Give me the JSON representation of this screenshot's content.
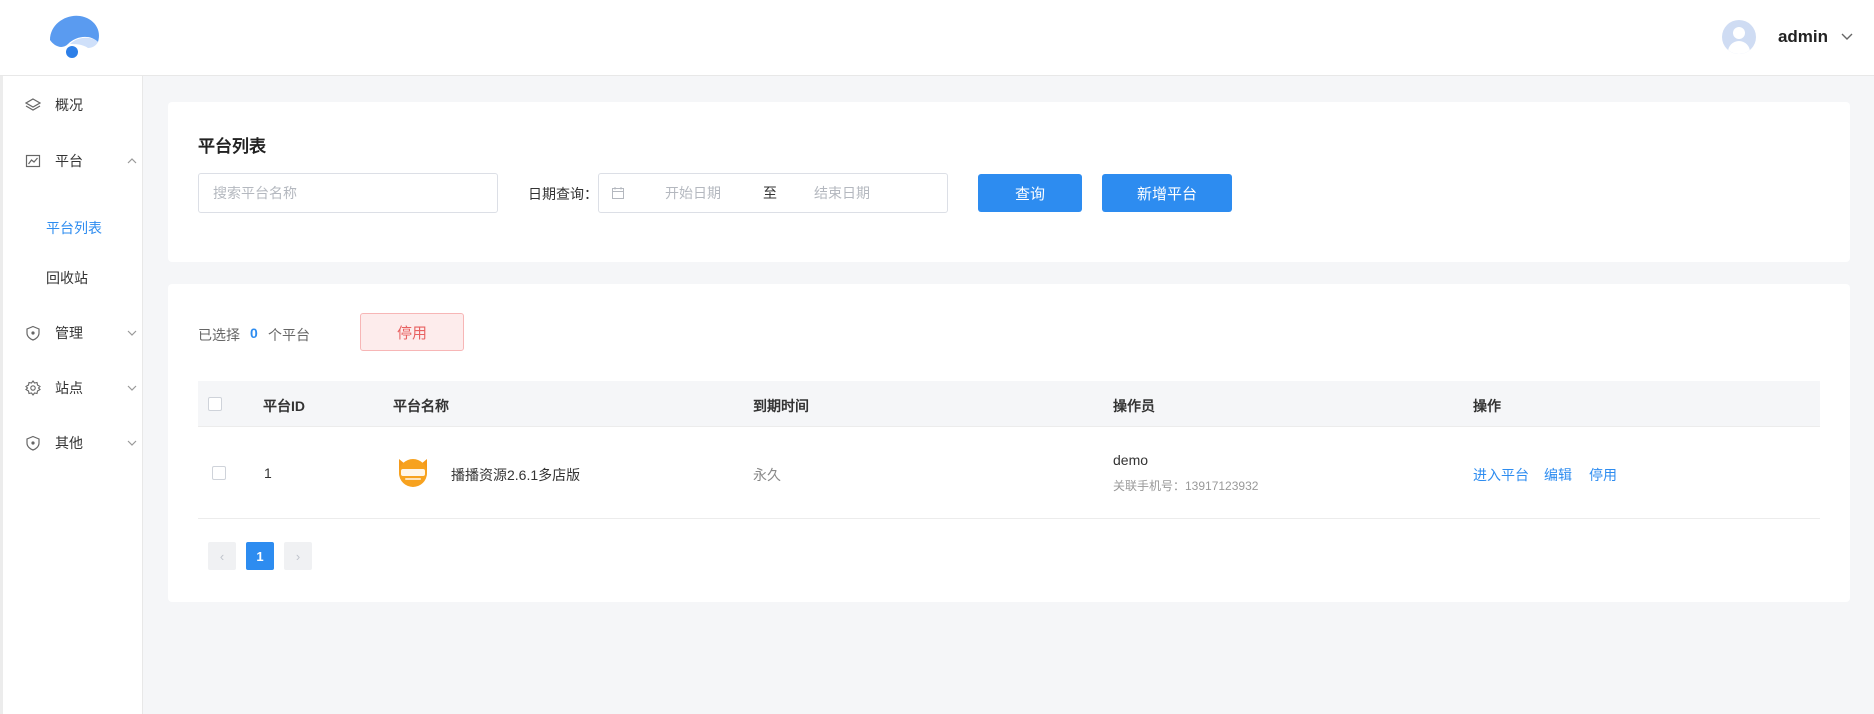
{
  "colors": {
    "primary": "#2d8cf0",
    "danger": "#e86161",
    "background": "#f5f6f8"
  },
  "header": {
    "user_name": "admin"
  },
  "sidebar": {
    "items": [
      {
        "label": "概况",
        "icon": "layers-icon"
      },
      {
        "label": "平台",
        "icon": "chart-icon",
        "expanded": true
      },
      {
        "label": "管理",
        "icon": "shield-icon"
      },
      {
        "label": "站点",
        "icon": "gear-icon"
      },
      {
        "label": "其他",
        "icon": "shield-icon"
      }
    ],
    "sub_items": [
      {
        "label": "平台列表",
        "active": true
      },
      {
        "label": "回收站",
        "active": false
      }
    ]
  },
  "filter": {
    "title": "平台列表",
    "search_placeholder": "搜索平台名称",
    "date_label": "日期查询：",
    "date_start_placeholder": "开始日期",
    "date_separator": "至",
    "date_end_placeholder": "结束日期",
    "query_button": "查询",
    "add_button": "新增平台"
  },
  "selection": {
    "prefix": "已选择",
    "count": "0",
    "suffix": "个平台",
    "disable_button": "停用"
  },
  "table": {
    "columns": [
      "平台ID",
      "平台名称",
      "到期时间",
      "操作员",
      "操作"
    ],
    "rows": [
      {
        "id": "1",
        "name": "播播资源2.6.1多店版",
        "expiry": "永久",
        "operator": "demo",
        "operator_phone": "关联手机号：13917123932",
        "actions": [
          "进入平台",
          "编辑",
          "停用"
        ]
      }
    ]
  },
  "pagination": {
    "current": "1",
    "prev": "‹",
    "next": "›"
  }
}
